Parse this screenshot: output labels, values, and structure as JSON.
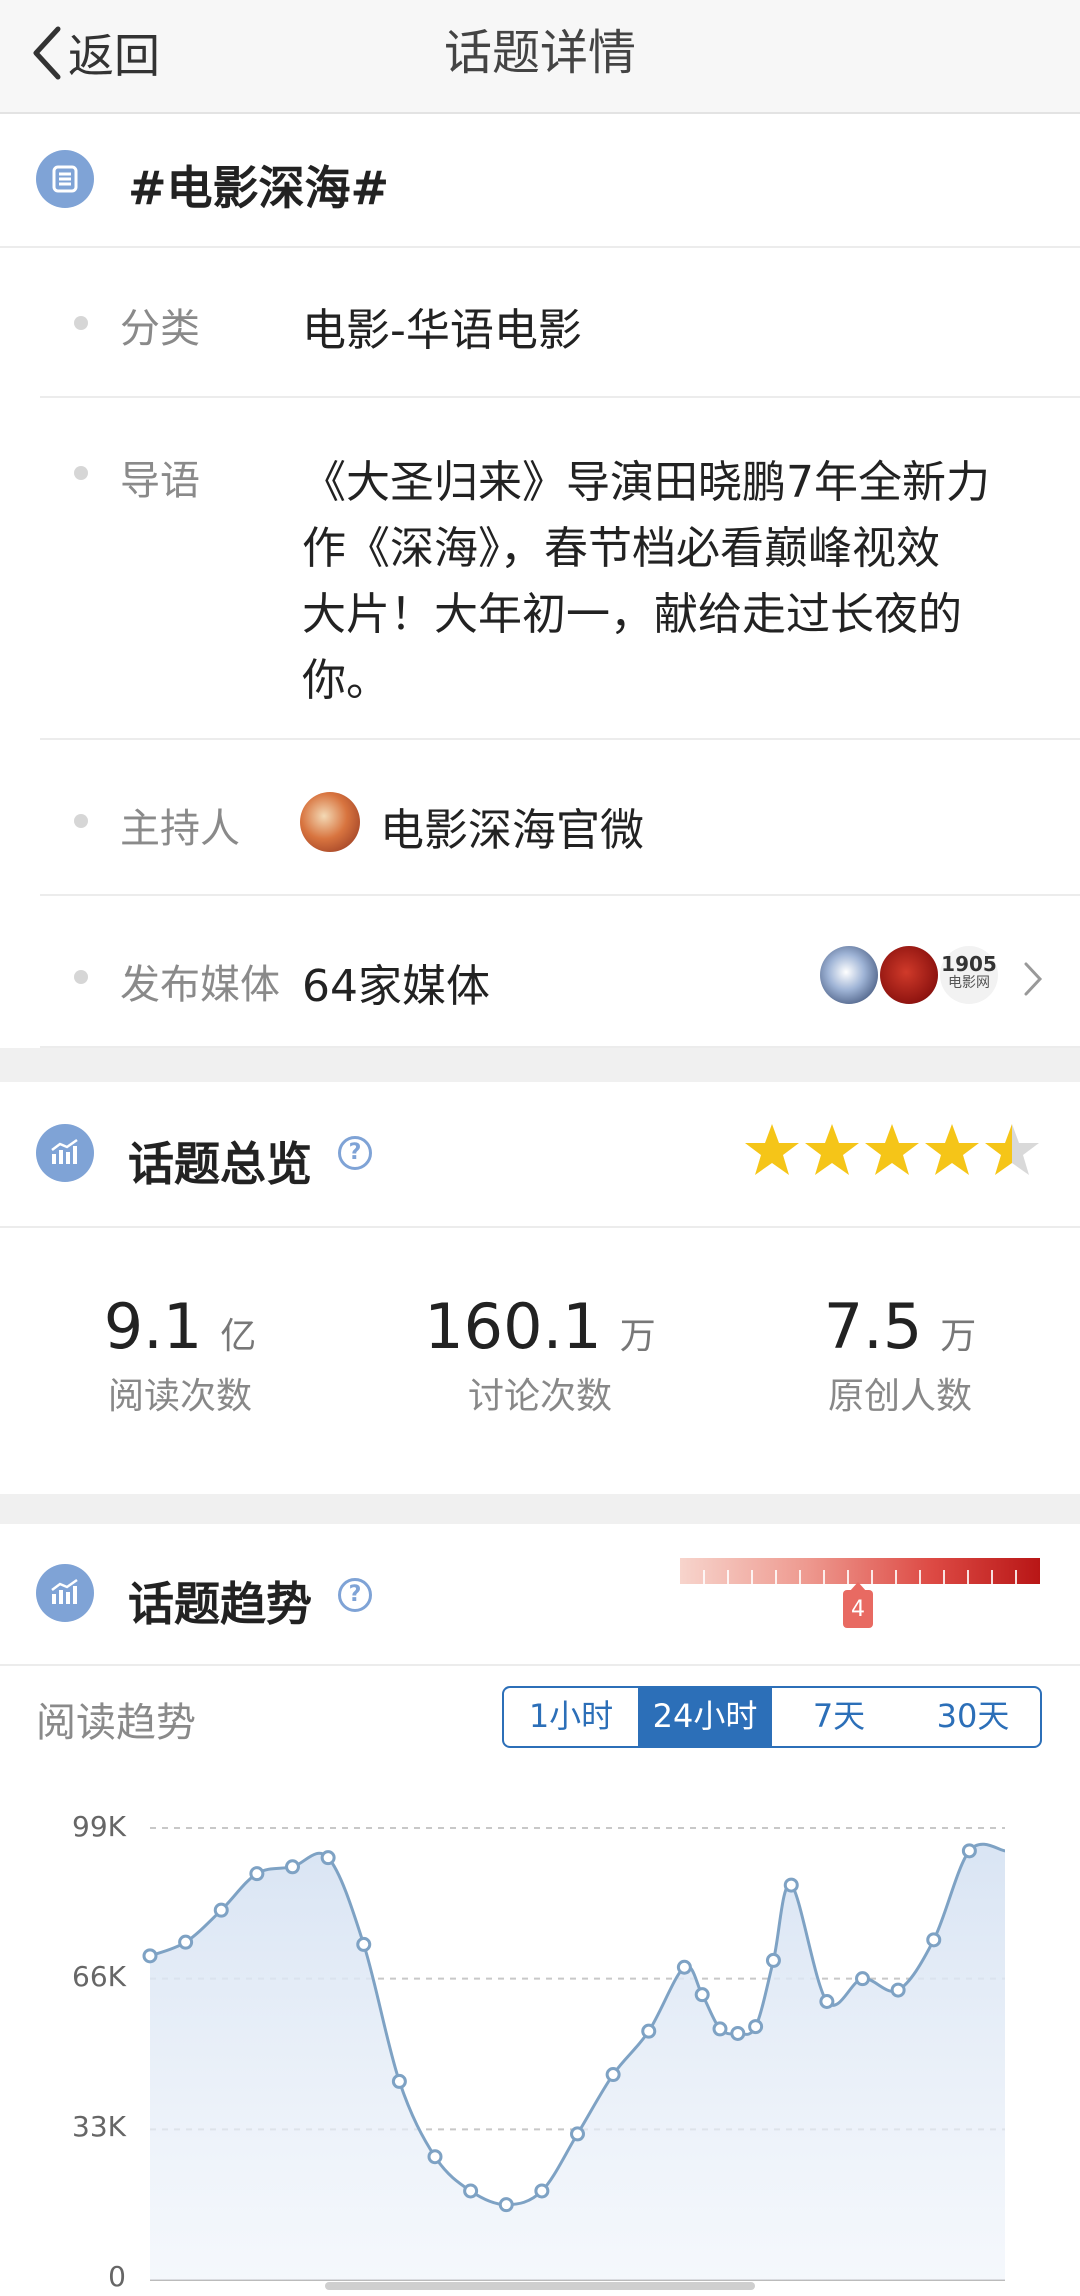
{
  "nav": {
    "back_label": "返回",
    "title": "话题详情"
  },
  "topic": {
    "name": "#电影深海#"
  },
  "info": {
    "category_label": "分类",
    "category_value": "电影-华语电影",
    "intro_label": "导语",
    "intro_lines": [
      "《大圣归来》导演田晓鹏7年全新力",
      "作《深海》，春节档必看巅峰视效",
      "大片！大年初一，献给走过长夜的",
      "你。"
    ],
    "host_label": "主持人",
    "host_value": "电影深海官微",
    "media_label": "发布媒体",
    "media_value": "64家媒体",
    "media_logo_text": [
      "1905",
      "电影网"
    ]
  },
  "overview": {
    "title": "话题总览",
    "help": "?",
    "rating_stars": 4.5,
    "stats": [
      {
        "value": "9.1",
        "unit": "亿",
        "label": "阅读次数"
      },
      {
        "value": "160.1",
        "unit": "万",
        "label": "讨论次数"
      },
      {
        "value": "7.5",
        "unit": "万",
        "label": "原创人数"
      }
    ]
  },
  "trend": {
    "title": "话题趋势",
    "help": "?",
    "heat_level": "4",
    "read_trend_label": "阅读趋势",
    "ranges": [
      "1小时",
      "24小时",
      "7天",
      "30天"
    ],
    "active_range": "24小时"
  },
  "colors": {
    "accent": "#2c6fb8",
    "icon_bg": "#7fa3d6",
    "star": "#f5c518",
    "line": "#7ea2c4"
  },
  "chart_data": {
    "type": "area",
    "y_ticks": [
      "99K",
      "66K",
      "33K",
      "0"
    ],
    "ylim": [
      0,
      99000
    ],
    "grid": true,
    "x": [
      0,
      1,
      2,
      3,
      4,
      5,
      6,
      7,
      8,
      9,
      10,
      11,
      12,
      13,
      14,
      15,
      15.5,
      16,
      16.5,
      17,
      17.5,
      18,
      19,
      20,
      21,
      22,
      23,
      24
    ],
    "values": [
      71000,
      74000,
      81000,
      89000,
      90500,
      92500,
      73500,
      43500,
      27000,
      19500,
      16500,
      19500,
      32000,
      45000,
      54500,
      68500,
      62500,
      55000,
      54000,
      55500,
      70000,
      86500,
      61000,
      66000,
      63500,
      74500,
      94000,
      94000
    ]
  }
}
